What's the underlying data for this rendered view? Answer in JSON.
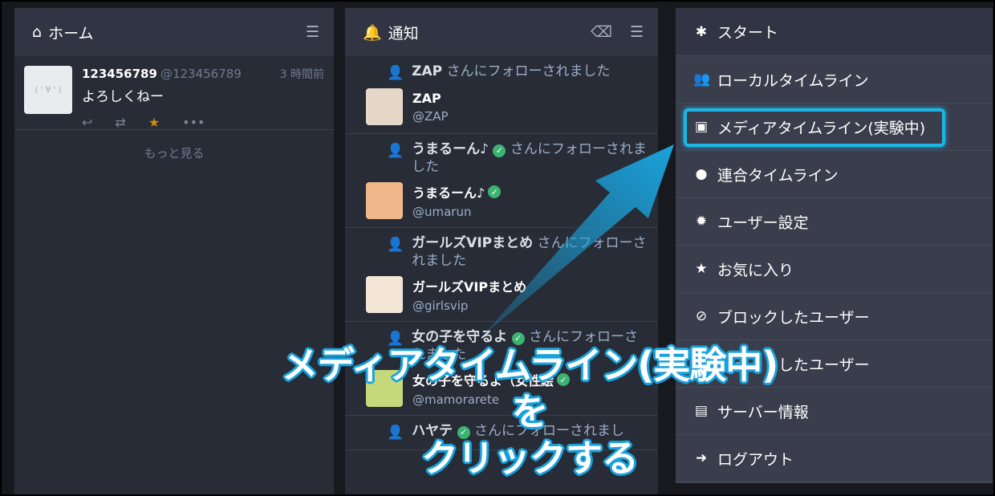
{
  "home": {
    "title": "ホーム",
    "status": {
      "display_name": "123456789",
      "acct": "@123456789",
      "time": "3 時間前",
      "avatar_text": "( ' ∀ ' )",
      "text": "よろしくねー"
    },
    "more": "もっと見る"
  },
  "notifications": {
    "title": "通知",
    "items": [
      {
        "who": "ZAP",
        "msg": " さんにフォローされました",
        "name": "ZAP",
        "acct": "@ZAP",
        "verified": false
      },
      {
        "who": "うまるーん♪",
        "msg": " さんにフォローされました",
        "name": "うまるーん♪",
        "acct": "@umarun",
        "verified": true
      },
      {
        "who": "ガールズVIPまとめ",
        "msg": " さんにフォローされました",
        "name": "ガールズVIPまとめ",
        "acct": "@girlsvip",
        "verified": false
      },
      {
        "who": "女の子を守るよ",
        "msg": " さんにフォローされました",
        "name": "女の子を守るよ（女性絵",
        "acct": "@mamorarete",
        "verified": true
      },
      {
        "who": "ハヤテ",
        "msg": " さんにフォローされまし",
        "name": "",
        "acct": "",
        "verified": true
      }
    ]
  },
  "menu": {
    "items": [
      {
        "icon": "asterisk-icon",
        "glyph": "✱",
        "label": "スタート"
      },
      {
        "icon": "users-icon",
        "glyph": "👥",
        "label": "ローカルタイムライン"
      },
      {
        "icon": "image-icon",
        "glyph": "▣",
        "label": "メディアタイムライン(実験中)"
      },
      {
        "icon": "globe-icon",
        "glyph": "●",
        "label": "連合タイムライン"
      },
      {
        "icon": "gear-icon",
        "glyph": "✹",
        "label": "ユーザー設定"
      },
      {
        "icon": "star-icon",
        "glyph": "★",
        "label": "お気に入り"
      },
      {
        "icon": "ban-icon",
        "glyph": "⊘",
        "label": "ブロックしたユーザー"
      },
      {
        "icon": "mute-icon",
        "glyph": "✕",
        "label": "ミュートしたユーザー"
      },
      {
        "icon": "book-icon",
        "glyph": "▤",
        "label": "サーバー情報"
      },
      {
        "icon": "logout-icon",
        "glyph": "➜",
        "label": "ログアウト"
      }
    ]
  },
  "annotation": {
    "line1": "メディアタイムライン(実験中)を",
    "line2": "クリックする",
    "color": "#1aa3dc"
  }
}
